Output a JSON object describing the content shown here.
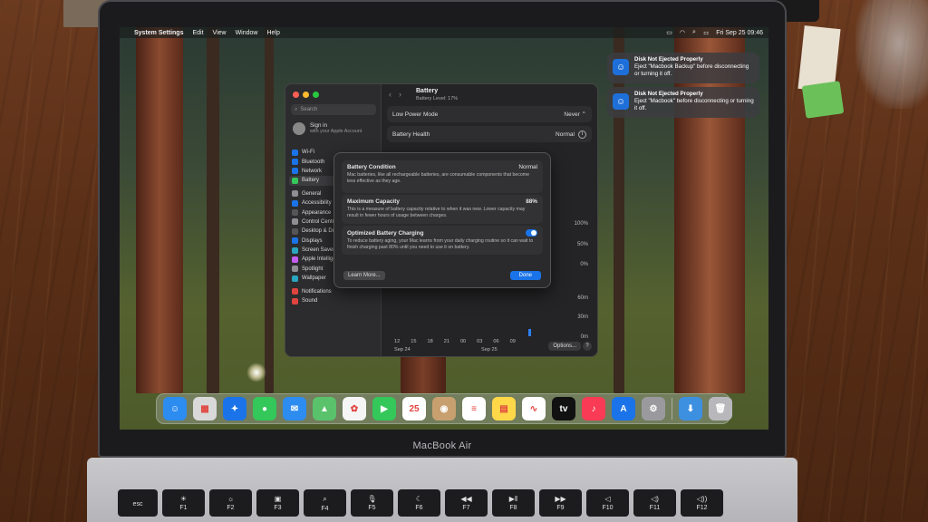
{
  "menubar": {
    "app_name": "System Settings",
    "items": [
      "Edit",
      "View",
      "Window",
      "Help"
    ],
    "clock": "Fri Sep 25 09:46"
  },
  "notifications": [
    {
      "title": "Disk Not Ejected Properly",
      "body": "Eject \"Macbook Backup\" before disconnecting or turning it off."
    },
    {
      "title": "Disk Not Ejected Properly",
      "body": "Eject \"Macbook\" before disconnecting or turning it off."
    }
  ],
  "sidebar": {
    "search_placeholder": "Search",
    "signin_title": "Sign in",
    "signin_sub": "with your Apple Account",
    "items": [
      {
        "label": "Wi-Fi",
        "color": "#1a73e8"
      },
      {
        "label": "Bluetooth",
        "color": "#1a73e8"
      },
      {
        "label": "Network",
        "color": "#1a73e8"
      },
      {
        "label": "Battery",
        "color": "#34c759"
      },
      {
        "label": "General",
        "color": "#8e8e93"
      },
      {
        "label": "Accessibility",
        "color": "#1a73e8"
      },
      {
        "label": "Appearance",
        "color": "#555"
      },
      {
        "label": "Control Centre",
        "color": "#8e8e93"
      },
      {
        "label": "Desktop & Dock",
        "color": "#555"
      },
      {
        "label": "Displays",
        "color": "#1a73e8"
      },
      {
        "label": "Screen Saver",
        "color": "#2aa5c0"
      },
      {
        "label": "Apple Intelligence & Siri",
        "color": "#c45cf0"
      },
      {
        "label": "Spotlight",
        "color": "#8e8e93"
      },
      {
        "label": "Wallpaper",
        "color": "#2aa5c0"
      },
      {
        "label": "Notifications",
        "color": "#e0443e"
      },
      {
        "label": "Sound",
        "color": "#e0443e"
      }
    ]
  },
  "battery_pane": {
    "title": "Battery",
    "subtitle": "Battery Level: 17%",
    "low_power_label": "Low Power Mode",
    "low_power_value": "Never",
    "health_label": "Battery Health",
    "health_value": "Normal",
    "y_labels": [
      "100%",
      "50%",
      "0%",
      "60m",
      "30m",
      "0m"
    ],
    "x_labels": [
      "12",
      "15",
      "18",
      "21",
      "00",
      "03",
      "06",
      "09"
    ],
    "x_dates": [
      "Sep 24",
      "Sep 25"
    ],
    "options_label": "Options...",
    "help_label": "?"
  },
  "sheet": {
    "condition_title": "Battery Condition",
    "condition_value": "Normal",
    "condition_body": "Mac batteries, like all rechargeable batteries, are consumable components that become less effective as they age.",
    "capacity_title": "Maximum Capacity",
    "capacity_value": "88%",
    "capacity_body": "This is a measure of battery capacity relative to when it was new. Lower capacity may result in fewer hours of usage between charges.",
    "optimized_title": "Optimized Battery Charging",
    "optimized_body": "To reduce battery aging, your Mac learns from your daily charging routine so it can wait to finish charging past 80% until you need to use it on battery.",
    "learn_more": "Learn More...",
    "done": "Done"
  },
  "dock": [
    {
      "name": "finder",
      "color": "#2d8cf0",
      "glyph": "☺"
    },
    {
      "name": "launchpad",
      "color": "#d9d9d9",
      "glyph": "▦"
    },
    {
      "name": "safari",
      "color": "#1a73e8",
      "glyph": "✦"
    },
    {
      "name": "messages",
      "color": "#34c759",
      "glyph": "●"
    },
    {
      "name": "mail",
      "color": "#2d8cf0",
      "glyph": "✉"
    },
    {
      "name": "maps",
      "color": "#5ac26b",
      "glyph": "▲"
    },
    {
      "name": "photos",
      "color": "#f5f5f5",
      "glyph": "✿"
    },
    {
      "name": "facetime",
      "color": "#34c759",
      "glyph": "▶"
    },
    {
      "name": "calendar",
      "color": "#ffffff",
      "glyph": "25"
    },
    {
      "name": "contacts",
      "color": "#c8a070",
      "glyph": "◉"
    },
    {
      "name": "reminders",
      "color": "#ffffff",
      "glyph": "≡"
    },
    {
      "name": "notes",
      "color": "#ffd84a",
      "glyph": "▤"
    },
    {
      "name": "freeform",
      "color": "#ffffff",
      "glyph": "∿"
    },
    {
      "name": "apple-tv",
      "color": "#111111",
      "glyph": "tv"
    },
    {
      "name": "music",
      "color": "#fa3b55",
      "glyph": "♪"
    },
    {
      "name": "app-store",
      "color": "#1a73e8",
      "glyph": "A"
    },
    {
      "name": "system-settings",
      "color": "#9a9a9e",
      "glyph": "⚙"
    }
  ],
  "dock_right": [
    {
      "name": "downloads",
      "color": "#3d8fe0",
      "glyph": "⬇"
    },
    {
      "name": "trash",
      "color": "#b8b8bc",
      "glyph": "🗑"
    }
  ],
  "laptop_brand": "MacBook Air",
  "keys": [
    {
      "top": "",
      "bottom": "esc",
      "w": 44
    },
    {
      "top": "☀",
      "bottom": "F1",
      "w": 47
    },
    {
      "top": "☼",
      "bottom": "F2",
      "w": 47
    },
    {
      "top": "▣",
      "bottom": "F3",
      "w": 47
    },
    {
      "top": "⌕",
      "bottom": "F4",
      "w": 47
    },
    {
      "top": "🎙",
      "bottom": "F5",
      "w": 47
    },
    {
      "top": "☾",
      "bottom": "F6",
      "w": 47
    },
    {
      "top": "◀◀",
      "bottom": "F7",
      "w": 47
    },
    {
      "top": "▶‖",
      "bottom": "F8",
      "w": 47
    },
    {
      "top": "▶▶",
      "bottom": "F9",
      "w": 47
    },
    {
      "top": "◁",
      "bottom": "F10",
      "w": 47
    },
    {
      "top": "◁)",
      "bottom": "F11",
      "w": 47
    },
    {
      "top": "◁))",
      "bottom": "F12",
      "w": 47
    }
  ]
}
